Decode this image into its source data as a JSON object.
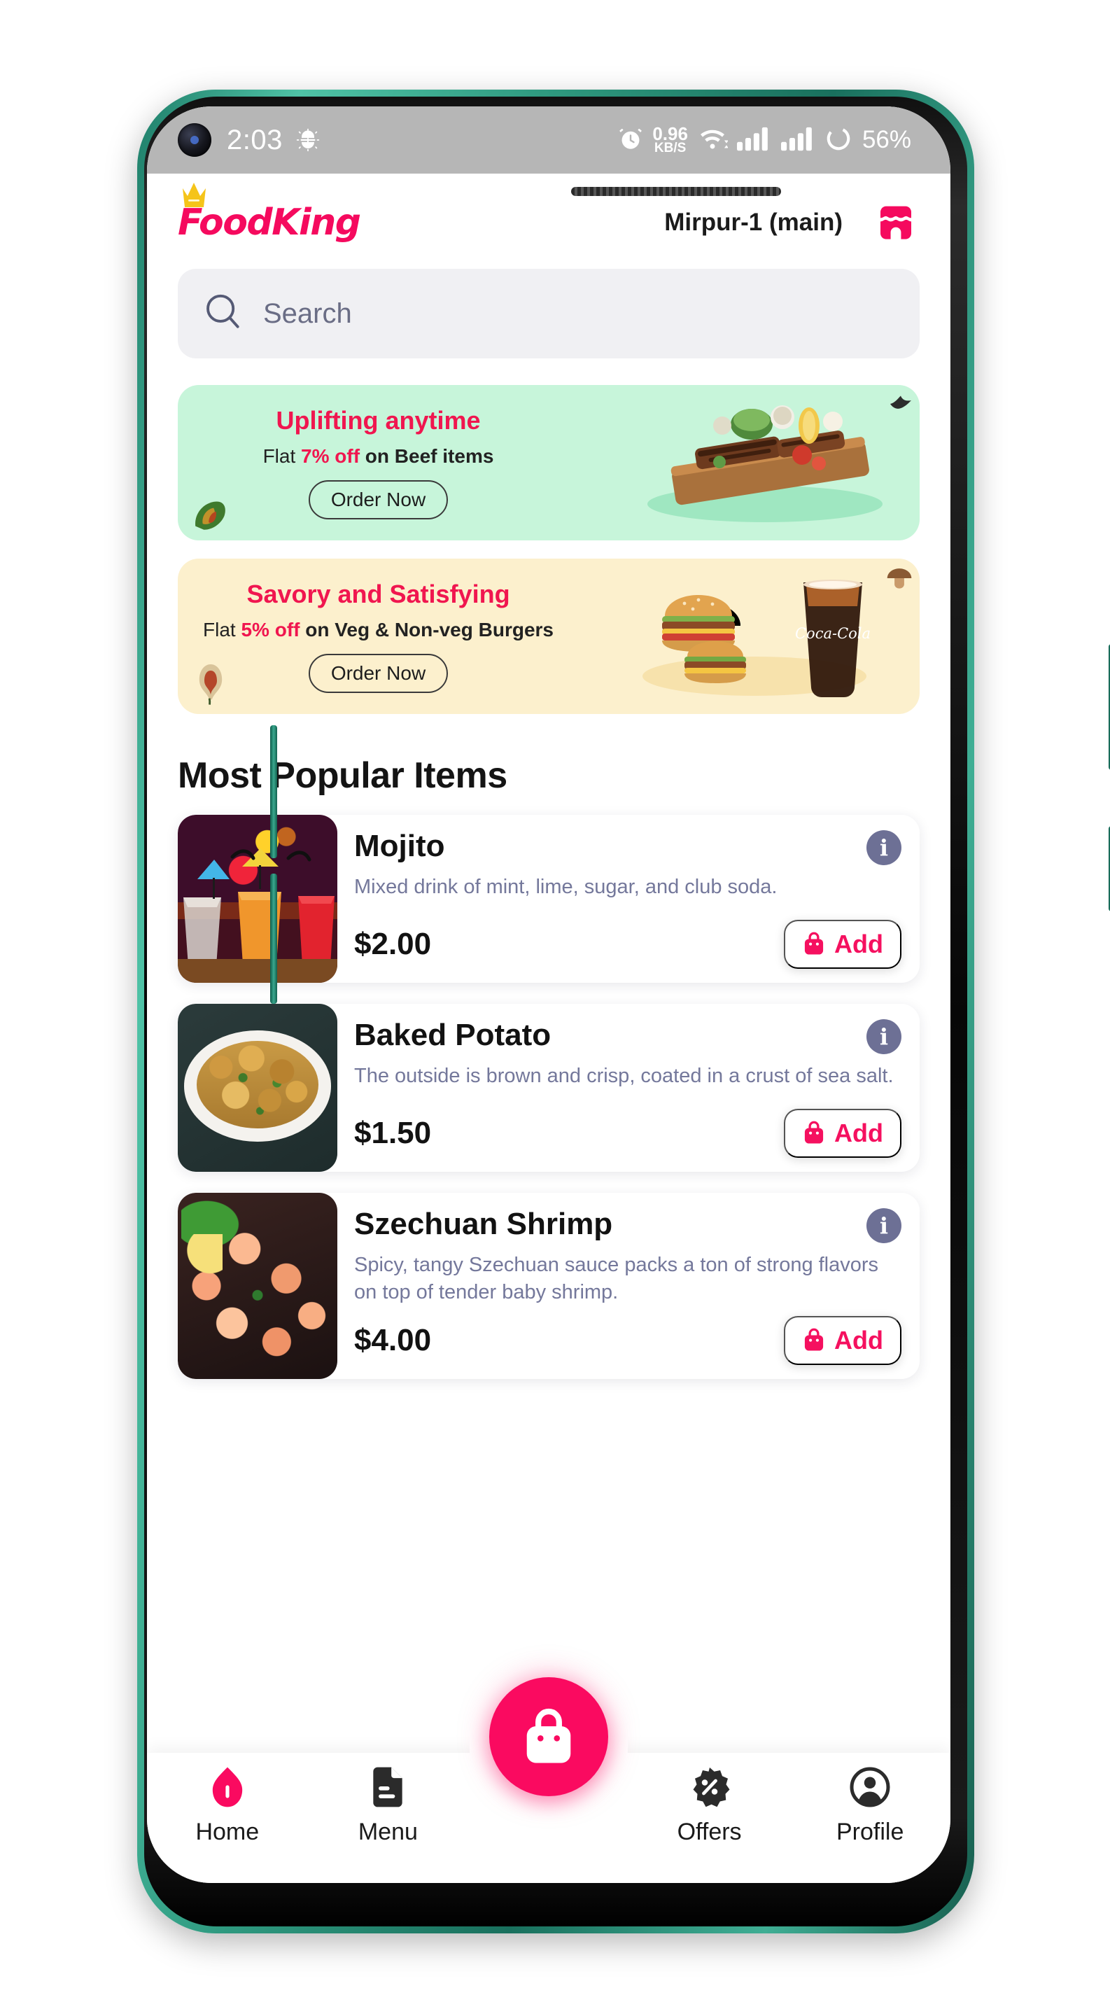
{
  "status_bar": {
    "time": "2:03",
    "left_icon": "android-gear-icon",
    "alarm_icon": "alarm-clock-icon",
    "net_speed_value": "0.96",
    "net_speed_unit": "KB/S",
    "wifi_icon": "wifi-icon",
    "signal_icon_1": "signal-bars-icon",
    "signal_icon_2": "signal-bars-icon",
    "battery_icon": "battery-circle-icon",
    "battery_percent": "56%",
    "background_color": "#b6b6b6"
  },
  "header": {
    "brand_name": "FoodKing",
    "brand_color": "#f50a5e",
    "crown_color": "#f5c419",
    "location": "Mirpur-1 (main)",
    "store_icon": "storefront-icon"
  },
  "search": {
    "placeholder": "Search",
    "icon": "search-icon"
  },
  "banners": [
    {
      "title": "Uplifting anytime",
      "sub_prefix": "Flat ",
      "sub_highlight": "7% off",
      "sub_suffix": " on Beef items",
      "button_label": "Order Now",
      "bg_color": "#c7f5da",
      "art": "grilled-beef-platter-image",
      "decor_left": "monstera-leaf-icon",
      "decor_right": "bird-icon"
    },
    {
      "title": "Savory and Satisfying",
      "sub_prefix": "Flat ",
      "sub_highlight": "5% off",
      "sub_suffix": " on Veg & Non-veg Burgers",
      "button_label": "Order Now",
      "bg_color": "#fcf0cd",
      "art": "burgers-and-cola-image",
      "decor_left": "dried-rose-icon",
      "decor_right": "mushroom-icon"
    }
  ],
  "section": {
    "title": "Most Popular Items"
  },
  "items": [
    {
      "name": "Mojito",
      "description": "Mixed drink of mint, lime, sugar, and club soda.",
      "price": "$2.00",
      "add_label": "Add",
      "info_label": "i",
      "bag_icon": "shopping-bag-icon",
      "image": "cocktail-glasses-image"
    },
    {
      "name": "Baked Potato",
      "description": "The outside is brown and crisp, coated in a crust of sea salt.",
      "price": "$1.50",
      "add_label": "Add",
      "info_label": "i",
      "bag_icon": "shopping-bag-icon",
      "image": "roasted-potatoes-plate-image"
    },
    {
      "name": "Szechuan Shrimp",
      "description": "Spicy, tangy Szechuan sauce packs a ton of strong flavors on top of tender baby shrimp.",
      "price": "$4.00",
      "add_label": "Add",
      "info_label": "i",
      "bag_icon": "shopping-bag-icon",
      "image": "szechuan-shrimp-pan-image"
    }
  ],
  "fab": {
    "icon": "shopping-bag-icon",
    "color": "#fa0a60"
  },
  "bottom_nav": {
    "items": [
      {
        "label": "Home",
        "icon": "home-icon",
        "active": true
      },
      {
        "label": "Menu",
        "icon": "menu-doc-icon",
        "active": false
      },
      {
        "label": "Offers",
        "icon": "discount-badge-icon",
        "active": false
      },
      {
        "label": "Profile",
        "icon": "user-circle-icon",
        "active": false
      }
    ],
    "active_color": "#fa0a60",
    "inactive_color": "#2b2b2b"
  }
}
